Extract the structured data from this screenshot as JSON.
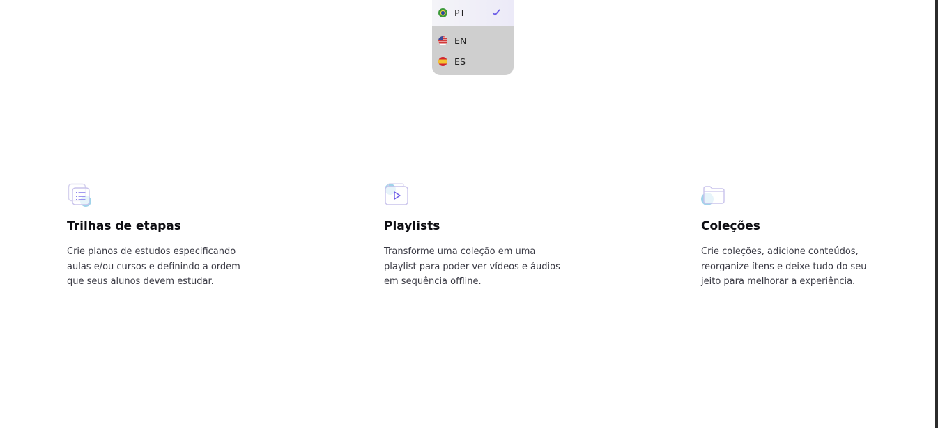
{
  "language_menu": {
    "options": [
      {
        "code": "PT",
        "flag": "brazil-flag",
        "selected": true
      },
      {
        "code": "EN",
        "flag": "usa-flag",
        "selected": false
      },
      {
        "code": "ES",
        "flag": "spain-flag",
        "selected": false
      }
    ],
    "accent_color": "#6b5ce7"
  },
  "features": [
    {
      "icon": "trail-list-icon",
      "title": "Trilhas de etapas",
      "description": "Crie planos de estudos especificando aulas e/ou cursos e definindo a ordem que seus alunos devem estudar."
    },
    {
      "icon": "playlist-icon",
      "title": "Playlists",
      "description": "Transforme uma coleção em uma playlist para poder ver vídeos e áudios em sequência offline."
    },
    {
      "icon": "folder-collection-icon",
      "title": "Coleções",
      "description": "Crie coleções, adicione conteúdos, reorganize ítens e deixe tudo do seu jeito para melhorar a experiência."
    }
  ]
}
